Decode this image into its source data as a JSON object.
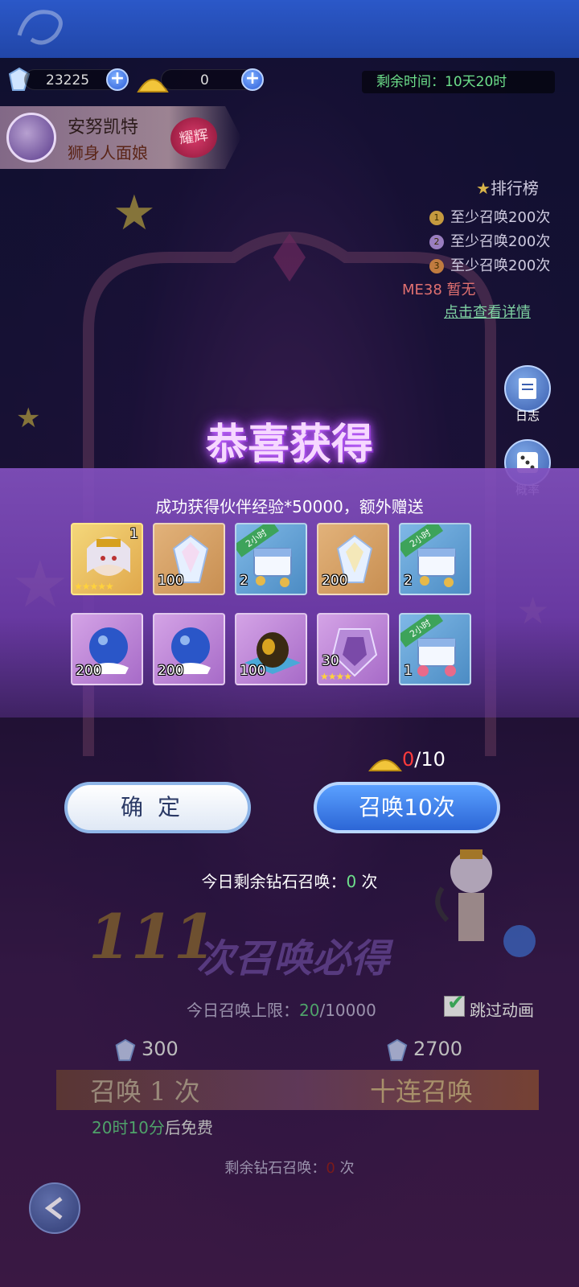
{
  "currency": {
    "gems": "23225",
    "gold": "0"
  },
  "event": {
    "time_label": "剩余时间：",
    "time_value": "10天20时"
  },
  "character": {
    "name": "安努凯特",
    "title": "狮身人面娘",
    "badge": "耀辉"
  },
  "ranking": {
    "title": "排行榜",
    "items": [
      {
        "rank": "1",
        "text": "至少召唤200次"
      },
      {
        "rank": "2",
        "text": "至少召唤200次"
      },
      {
        "rank": "3",
        "text": "至少召唤200次"
      }
    ],
    "me": "ME38",
    "me_tail": "  暂无",
    "detail_link": "点击查看详情"
  },
  "side_buttons": {
    "log": "日志",
    "rate": "概率"
  },
  "modal": {
    "title": "恭喜获得",
    "subtitle": "成功获得伙伴经验*50000，额外赠送",
    "items": [
      {
        "type": "portrait",
        "count": "1",
        "stars": "★★★★★"
      },
      {
        "type": "gold",
        "icon": "crystal-icon",
        "count": "100"
      },
      {
        "type": "blue",
        "icon": "treasure-chest-icon",
        "count": "2",
        "tag": "2小时"
      },
      {
        "type": "gold",
        "icon": "crystal-icon",
        "count": "200"
      },
      {
        "type": "blue",
        "icon": "treasure-chest-icon",
        "count": "2",
        "tag": "2小时"
      },
      {
        "type": "purple",
        "icon": "crystal-orb-icon",
        "count": "200"
      },
      {
        "type": "purple",
        "icon": "crystal-orb-icon",
        "count": "200"
      },
      {
        "type": "purple",
        "icon": "golden-egg-icon",
        "count": "100"
      },
      {
        "type": "purple",
        "icon": "purple-gem-icon",
        "count": "30",
        "stars": "★★★★"
      },
      {
        "type": "blue",
        "icon": "pink-chest-icon",
        "count": "1",
        "tag": "2小时"
      }
    ],
    "cost_current": "0",
    "cost_total": "/10",
    "confirm_label": "确定",
    "summon_label": "召唤10次",
    "today_left_prefix": "今日剩余钻石召唤：",
    "today_left_value": "0",
    "today_left_suffix": " 次"
  },
  "background": {
    "guarantee_count": "111",
    "guarantee_text": "次召唤必得",
    "limit_prefix": "今日召唤上限：",
    "limit_value": "20",
    "limit_total": "/10000",
    "skip_label": "跳过动画",
    "price_single": "300",
    "price_ten": "2700",
    "summon_one": "召唤 1 次",
    "summon_ten": "十连召唤",
    "free_time": "20时10分",
    "free_suffix": "后免费",
    "remain_prefix": "剩余钻石召唤：",
    "remain_value": "0",
    "remain_suffix": " 次"
  },
  "colors": {
    "accent_green": "#6de08b",
    "modal_purple": "#8e55c8",
    "button_blue": "#2c66d6"
  }
}
